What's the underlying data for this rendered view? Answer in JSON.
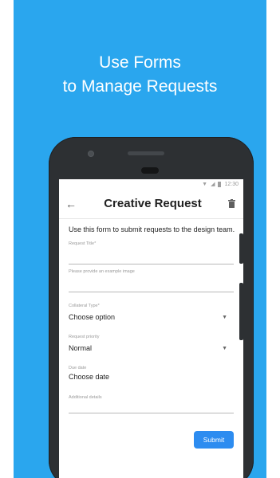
{
  "headline": {
    "line1": "Use Forms",
    "line2": "to Manage Requests"
  },
  "status_bar": {
    "time": "12:30"
  },
  "app_bar": {
    "title": "Creative Request"
  },
  "form": {
    "intro": "Use this form to submit requests to the design team.",
    "fields": [
      {
        "label": "Request Title*",
        "value": ""
      },
      {
        "label": "Please provide an example image",
        "value": ""
      },
      {
        "label": "Collateral Type*",
        "value": "Choose option"
      },
      {
        "label": "Request priority",
        "value": "Normal"
      },
      {
        "label": "Due date",
        "value": "Choose date"
      },
      {
        "label": "Additional details",
        "value": ""
      }
    ],
    "submit_label": "Submit"
  },
  "colors": {
    "background": "#2aa6ee",
    "accent": "#2d8cf0",
    "phone_body": "#2d3033"
  },
  "icons": [
    "back-arrow-icon",
    "trash-icon",
    "wifi-icon",
    "signal-icon",
    "battery-icon",
    "caret-down-icon"
  ]
}
